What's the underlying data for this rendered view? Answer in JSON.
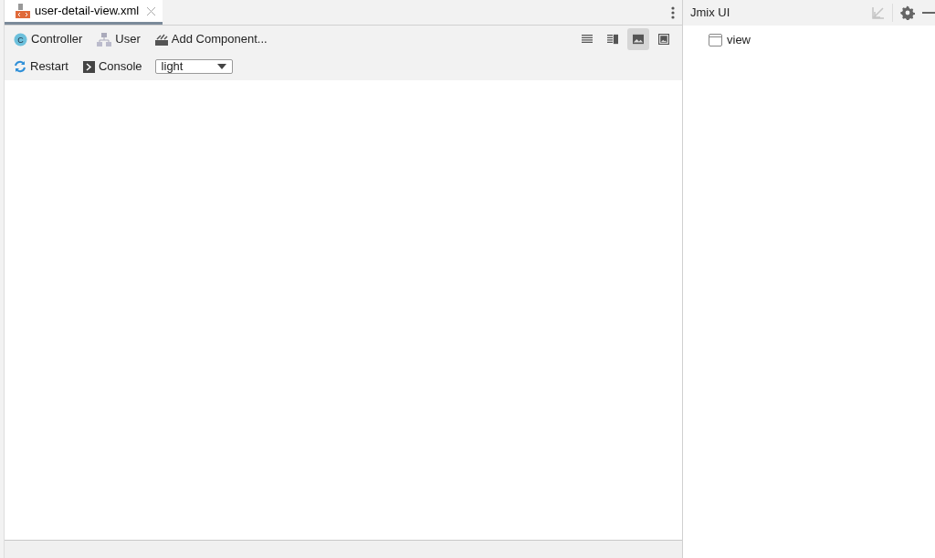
{
  "editor_tabs": [
    {
      "label": "user-detail-view.xml",
      "selected": true
    }
  ],
  "toolbar": [
    {
      "kind": "controller",
      "icon_text": "C",
      "label": "Controller"
    },
    {
      "kind": "entity",
      "label": "User"
    },
    {
      "kind": "add",
      "label": "Add Component..."
    }
  ],
  "view_modes": [
    {
      "kind": "text",
      "selected": false
    },
    {
      "kind": "split",
      "selected": false
    },
    {
      "kind": "preview",
      "selected": true
    },
    {
      "kind": "framed",
      "selected": false
    }
  ],
  "preview_bar": {
    "restart": "Restart",
    "console": "Console",
    "theme": "light"
  },
  "side_panel": {
    "title": "Jmix UI",
    "tree": [
      {
        "label": "view"
      }
    ]
  }
}
